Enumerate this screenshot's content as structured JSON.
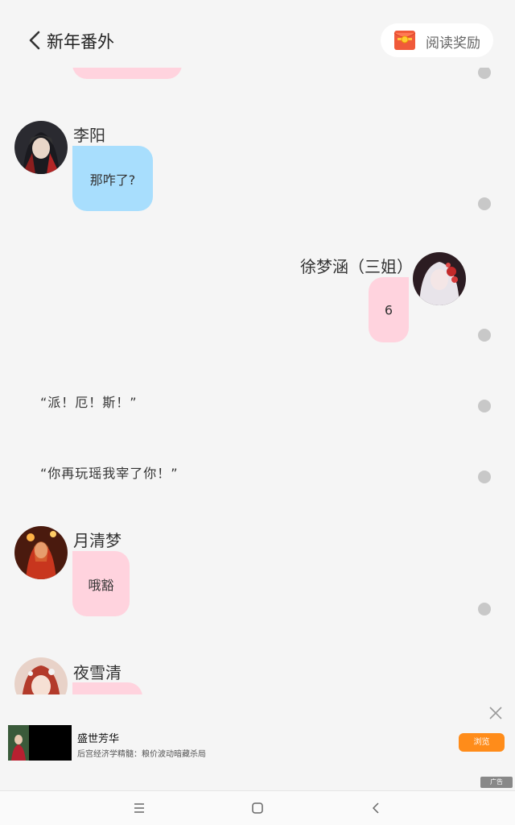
{
  "header": {
    "title": "新年番外",
    "back_icon": "chevron-left-icon",
    "reward_label": "阅读奖励",
    "reward_icon": "red-envelope-icon"
  },
  "messages": [
    {
      "type": "bubble",
      "side": "left",
      "color": "#ffd3de",
      "text": "",
      "partial": "top"
    },
    {
      "type": "bubble",
      "side": "left",
      "name": "李阳",
      "color": "#a8defd",
      "text": "那咋了?"
    },
    {
      "type": "bubble",
      "side": "right",
      "name": "徐梦涵（三姐）",
      "color": "#ffd3de",
      "text": "6"
    },
    {
      "type": "narration",
      "text": "“派！厄！斯！”"
    },
    {
      "type": "narration",
      "text": "“你再玩瑶我宰了你！”"
    },
    {
      "type": "bubble",
      "side": "left",
      "name": "月清梦",
      "color": "#ffd3de",
      "text": "哦豁"
    },
    {
      "type": "bubble",
      "side": "left",
      "name": "夜雪清",
      "color": "#ffd3de",
      "text": "",
      "partial": "bottom"
    }
  ],
  "ad": {
    "title": "盛世芳华",
    "subtitle": "后宫经济学精髓：粮价波动暗藏杀局",
    "button_label": "浏览",
    "tag": "广告",
    "close_icon": "close-icon"
  },
  "navbar": {
    "menu_icon": "menu-icon",
    "home_icon": "home-square-icon",
    "back_icon": "back-triangle-icon"
  },
  "colors": {
    "background": "#f5f5f5",
    "pink_bubble": "#ffd3de",
    "blue_bubble": "#a8defd",
    "ad_button": "#ff8c1a"
  }
}
